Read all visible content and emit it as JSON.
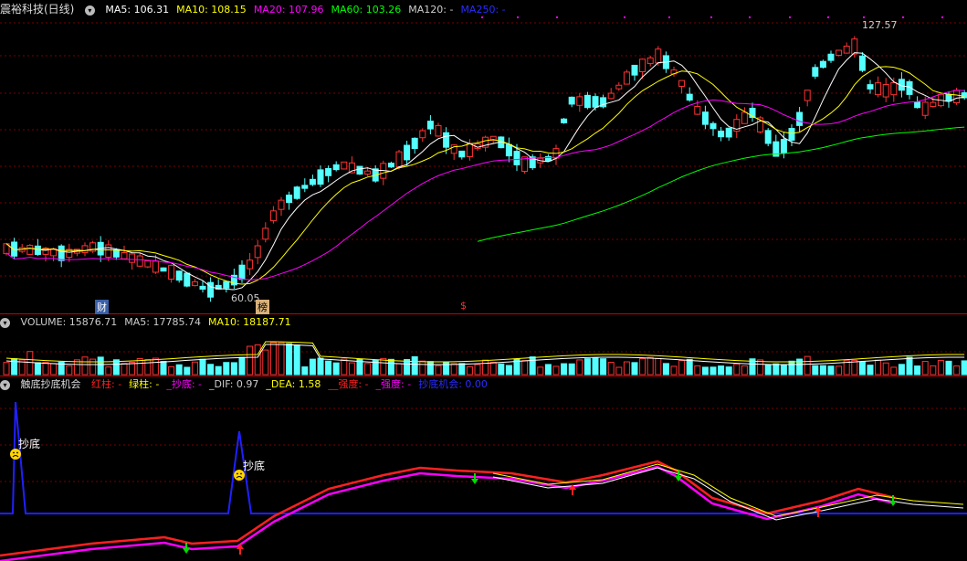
{
  "price_panel": {
    "stock_name": "震裕科技(日线)",
    "ma_items": [
      {
        "label": "MA5: 106.31",
        "color": "#ffffff"
      },
      {
        "label": "MA10: 108.15",
        "color": "#ffff00"
      },
      {
        "label": "MA20: 107.96",
        "color": "#ff00ff"
      },
      {
        "label": "MA60: 103.26",
        "color": "#00ff00"
      },
      {
        "label": "MA120: -",
        "color": "#cccccc"
      },
      {
        "label": "MA250: -",
        "color": "#2b2bff"
      }
    ],
    "high_label": "127.57",
    "low_label": "60.05",
    "markers": [
      "财",
      "榜",
      "$"
    ]
  },
  "volume_panel": {
    "items": [
      {
        "label": "VOLUME: 15876.71",
        "color": "#cccccc"
      },
      {
        "label": "MA5: 17785.74",
        "color": "#cccccc"
      },
      {
        "label": "MA10: 18187.71",
        "color": "#ffff00"
      }
    ]
  },
  "indicator_panel": {
    "name": "触底抄底机会",
    "items": [
      {
        "label": "红柱: -",
        "color": "#ff2020"
      },
      {
        "label": "绿柱: -",
        "color": "#ffff00"
      },
      {
        "label": "_抄底: -",
        "color": "#ff00ff"
      },
      {
        "label": "_DIF: 0.97",
        "color": "#cccccc"
      },
      {
        "label": "_DEA: 1.58",
        "color": "#ffff00"
      },
      {
        "label": "__强度: -",
        "color": "#ff2020"
      },
      {
        "label": "_强度: -",
        "color": "#ff00ff"
      },
      {
        "label": "抄底机会: 0.00",
        "color": "#2b2bff"
      }
    ],
    "signal_label": "抄底"
  },
  "colors": {
    "up": "#ff3232",
    "down": "#54ffff",
    "grid": "#7a0000",
    "separator": "#c00000"
  }
}
